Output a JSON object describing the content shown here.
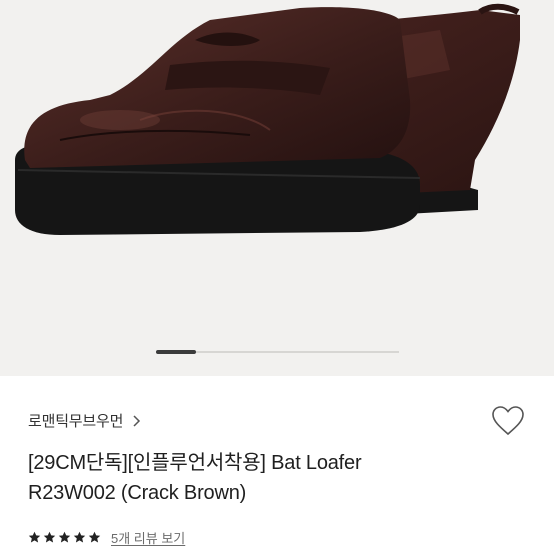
{
  "product": {
    "brand": "로맨틱무브우먼",
    "title_line1": "[29CM단독][인플루언서착용] Bat Loafer",
    "title_line2": "R23W002 (Crack Brown)",
    "rating": {
      "stars": 5,
      "review_link": "5개 리뷰 보기"
    }
  },
  "carousel": {
    "position": 0.17
  },
  "icons": {
    "brand_arrow": "chevron-right-icon",
    "wishlist": "heart-outline-icon",
    "star": "star-icon"
  },
  "colors": {
    "leather": "#3a1d1a",
    "sole": "#141414",
    "background": "#f2f1ef"
  }
}
